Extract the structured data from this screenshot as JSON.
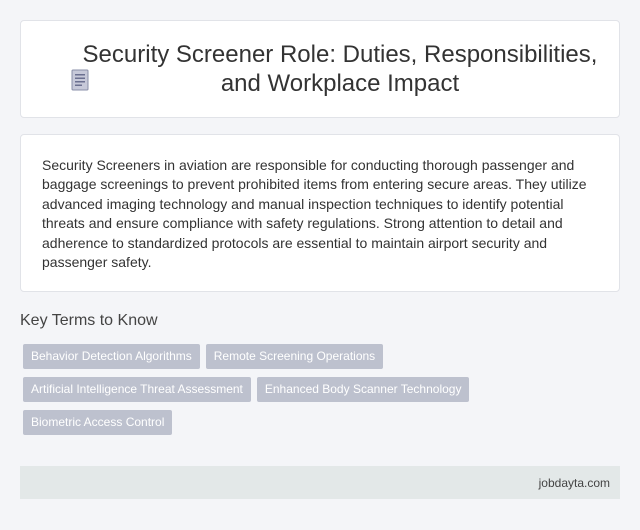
{
  "header": {
    "icon": "document-icon",
    "title": "Security Screener Role: Duties, Responsibilities, and Workplace Impact"
  },
  "summary": {
    "text": "Security Screeners in aviation are responsible for conducting thorough passenger and baggage screenings to prevent prohibited items from entering secure areas. They utilize advanced imaging technology and manual inspection techniques to identify potential threats and ensure compliance with safety regulations. Strong attention to detail and adherence to standardized protocols are essential to maintain airport security and passenger safety."
  },
  "key_terms": {
    "heading": "Key Terms to Know",
    "tags": [
      "Behavior Detection Algorithms",
      "Remote Screening Operations",
      "Artificial Intelligence Threat Assessment",
      "Enhanced Body Scanner Technology",
      "Biometric Access Control"
    ]
  },
  "footer": {
    "site": "jobdayta.com"
  },
  "colors": {
    "tag_bg": "#bdc1ce",
    "footer_bg": "#e3e8e8",
    "page_bg": "#f4f5f8"
  }
}
